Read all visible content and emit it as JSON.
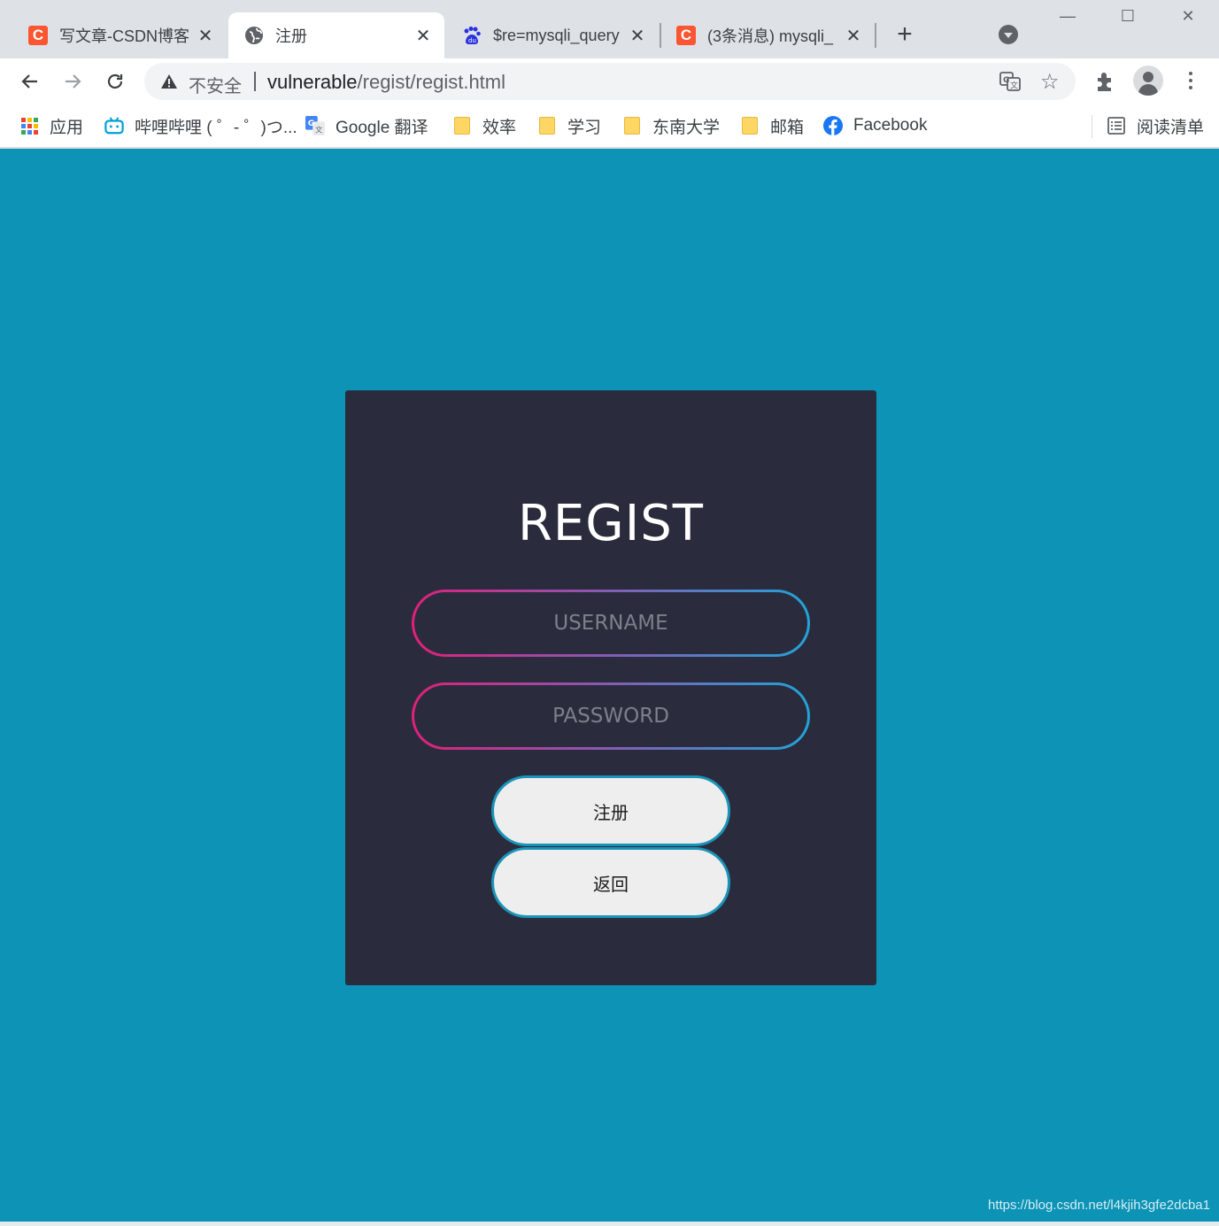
{
  "tabs": [
    {
      "title": "写文章-CSDN博客",
      "favicon": "csdn-icon"
    },
    {
      "title": "注册",
      "favicon": "globe-icon",
      "active": true
    },
    {
      "title": "$re=mysqli_query",
      "favicon": "baidu-icon"
    },
    {
      "title": "(3条消息) mysqli_",
      "favicon": "csdn-icon"
    }
  ],
  "address_bar": {
    "security_label": "不安全",
    "url_host": "vulnerable",
    "url_path": "/regist/regist.html"
  },
  "bookmarks": [
    {
      "label": "应用",
      "icon": "apps-icon"
    },
    {
      "label": "哔哩哔哩 ( ゜- ゜)つ...",
      "icon": "bilibili-icon"
    },
    {
      "label": "Google 翻译",
      "icon": "google-translate-icon"
    },
    {
      "label": "效率",
      "icon": "folder-icon"
    },
    {
      "label": "学习",
      "icon": "folder-icon"
    },
    {
      "label": "东南大学",
      "icon": "folder-icon"
    },
    {
      "label": "邮箱",
      "icon": "folder-icon"
    },
    {
      "label": "Facebook",
      "icon": "facebook-icon"
    }
  ],
  "reading_list": "阅读清单",
  "form": {
    "title": "REGIST",
    "username_placeholder": "USERNAME",
    "password_placeholder": "PASSWORD",
    "register_label": "注册",
    "back_label": "返回"
  },
  "watermark": "https://blog.csdn.net/l4kjih3gfe2dcba1",
  "colors": {
    "page_bg": "#0c93b5",
    "card_bg": "#2a2c3d",
    "gradient_start": "#e0207a",
    "gradient_end": "#22a3d7",
    "button_bg": "#eeeeee",
    "csdn": "#fc5531"
  }
}
